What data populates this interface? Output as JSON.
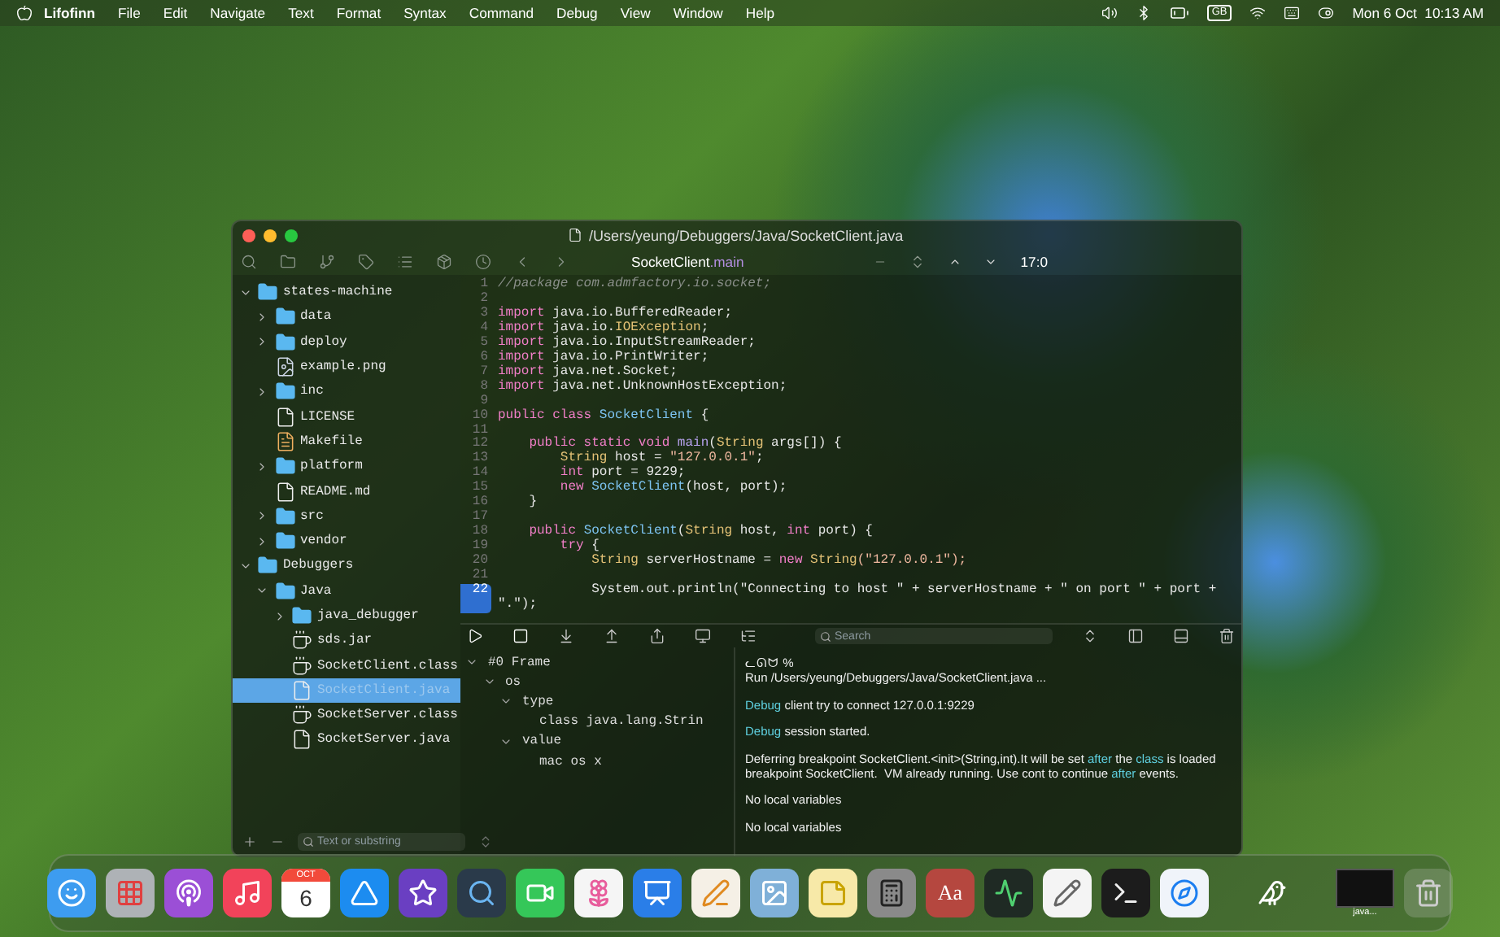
{
  "menu_bar": {
    "app_name": "Lifofinn",
    "menus": [
      "File",
      "Edit",
      "Navigate",
      "Text",
      "Format",
      "Syntax",
      "Command",
      "Debug",
      "View",
      "Window",
      "Help"
    ],
    "input_source": "GB",
    "clock": "Mon 6 Oct  10:13 AM"
  },
  "window": {
    "title": "/Users/yeung/Debuggers/Java/SocketClient.java",
    "breadcrumb": {
      "symbol": "SocketClient",
      "member": ".main"
    },
    "cursor_position": "17:0"
  },
  "sidebar": {
    "tree": [
      {
        "label": "states-machine",
        "kind": "folder",
        "expanded": true,
        "selected": false,
        "children": [
          {
            "label": "data",
            "kind": "folder",
            "expanded": false,
            "selected": false
          },
          {
            "label": "deploy",
            "kind": "folder",
            "expanded": false,
            "selected": false
          },
          {
            "label": "example.png",
            "kind": "image",
            "selected": false
          },
          {
            "label": "inc",
            "kind": "folder",
            "expanded": false,
            "selected": false
          },
          {
            "label": "LICENSE",
            "kind": "document",
            "selected": false
          },
          {
            "label": "Makefile",
            "kind": "makefile",
            "selected": false
          },
          {
            "label": "platform",
            "kind": "folder",
            "expanded": false,
            "selected": false
          },
          {
            "label": "README.md",
            "kind": "document",
            "selected": false
          },
          {
            "label": "src",
            "kind": "folder",
            "expanded": false,
            "selected": false
          },
          {
            "label": "vendor",
            "kind": "folder",
            "expanded": false,
            "selected": false
          }
        ]
      },
      {
        "label": "Debuggers",
        "kind": "folder",
        "expanded": true,
        "selected": false,
        "children": [
          {
            "label": "Java",
            "kind": "folder",
            "expanded": true,
            "selected": false,
            "children": [
              {
                "label": "java_debugger",
                "kind": "folder",
                "expanded": false,
                "selected": false
              },
              {
                "label": "sds.jar",
                "kind": "archive",
                "selected": false
              },
              {
                "label": "SocketClient.class",
                "kind": "archive",
                "selected": false
              },
              {
                "label": "SocketClient.java",
                "kind": "document",
                "selected": true
              },
              {
                "label": "SocketServer.class",
                "kind": "archive",
                "selected": false
              },
              {
                "label": "SocketServer.java",
                "kind": "document",
                "selected": false
              }
            ]
          }
        ]
      }
    ],
    "filter": {
      "placeholder": "Text or substring"
    }
  },
  "editor": {
    "lines": [
      {
        "number": "1",
        "current": false,
        "tokens": [
          {
            "kind": "comment",
            "text": "//package com.admfactory.io.socket;"
          }
        ]
      },
      {
        "number": "2",
        "current": false
      },
      {
        "number": "3",
        "current": false,
        "tokens": [
          {
            "kind": "keyword",
            "text": "import"
          },
          {
            "kind": "plain",
            "text": " java.io.BufferedReader;"
          }
        ]
      },
      {
        "number": "4",
        "current": false,
        "tokens": [
          {
            "kind": "keyword",
            "text": "import"
          },
          {
            "kind": "plain",
            "text": " java.io."
          },
          {
            "kind": "type",
            "text": "IOException"
          },
          {
            "kind": "plain",
            "text": ";"
          }
        ]
      },
      {
        "number": "5",
        "current": false,
        "tokens": [
          {
            "kind": "keyword",
            "text": "import"
          },
          {
            "kind": "plain",
            "text": " java.io.InputStreamReader;"
          }
        ]
      },
      {
        "number": "6",
        "current": false,
        "tokens": [
          {
            "kind": "keyword",
            "text": "import"
          },
          {
            "kind": "plain",
            "text": " java.io.PrintWriter;"
          }
        ]
      },
      {
        "number": "7",
        "current": false,
        "tokens": [
          {
            "kind": "keyword",
            "text": "import"
          },
          {
            "kind": "plain",
            "text": " java.net.Socket;"
          }
        ]
      },
      {
        "number": "8",
        "current": false,
        "tokens": [
          {
            "kind": "keyword",
            "text": "import"
          },
          {
            "kind": "plain",
            "text": " java.net.UnknownHostException;"
          }
        ]
      },
      {
        "number": "9",
        "current": false
      },
      {
        "number": "10",
        "current": false,
        "tokens": [
          {
            "kind": "keyword",
            "text": "public class "
          },
          {
            "kind": "class",
            "text": "SocketClient"
          },
          {
            "kind": "plain",
            "text": " {"
          }
        ]
      },
      {
        "number": "11",
        "current": false
      },
      {
        "number": "12",
        "current": false,
        "tokens": [
          {
            "kind": "keyword",
            "text": "    public static void "
          },
          {
            "kind": "function",
            "text": "main"
          },
          {
            "kind": "plain",
            "text": "("
          },
          {
            "kind": "type",
            "text": "String"
          },
          {
            "kind": "plain",
            "text": " args[]) {"
          }
        ]
      },
      {
        "number": "13",
        "current": false,
        "tokens": [
          {
            "kind": "type",
            "text": "        String"
          },
          {
            "kind": "plain",
            "text": " host = "
          },
          {
            "kind": "string",
            "text": "\"127.0.0.1\""
          },
          {
            "kind": "plain",
            "text": ";"
          }
        ]
      },
      {
        "number": "14",
        "current": false,
        "tokens": [
          {
            "kind": "keyword",
            "text": "        int"
          },
          {
            "kind": "plain",
            "text": " port = 9229;"
          }
        ]
      },
      {
        "number": "15",
        "current": false,
        "tokens": [
          {
            "kind": "keyword",
            "text": "        new "
          },
          {
            "kind": "class",
            "text": "SocketClient"
          },
          {
            "kind": "plain",
            "text": "(host, port);"
          }
        ]
      },
      {
        "number": "16",
        "current": false,
        "tokens": [
          {
            "kind": "plain",
            "text": "    }"
          }
        ]
      },
      {
        "number": "17",
        "current": false
      },
      {
        "number": "18",
        "current": false,
        "tokens": [
          {
            "kind": "keyword",
            "text": "    public "
          },
          {
            "kind": "class",
            "text": "SocketClient"
          },
          {
            "kind": "plain",
            "text": "("
          },
          {
            "kind": "type",
            "text": "String"
          },
          {
            "kind": "plain",
            "text": " host, "
          },
          {
            "kind": "keyword",
            "text": "int"
          },
          {
            "kind": "plain",
            "text": " port) {"
          }
        ]
      },
      {
        "number": "19",
        "current": false,
        "tokens": [
          {
            "kind": "keyword",
            "text": "        try"
          },
          {
            "kind": "plain",
            "text": " {"
          }
        ]
      },
      {
        "number": "20",
        "current": false,
        "tokens": [
          {
            "kind": "type",
            "text": "            String"
          },
          {
            "kind": "plain",
            "text": " serverHostname = "
          },
          {
            "kind": "keyword",
            "text": "new "
          },
          {
            "kind": "type",
            "text": "String"
          },
          {
            "kind": "string",
            "text": "(\"127.0.0.1\");"
          }
        ]
      },
      {
        "number": "21",
        "current": false
      },
      {
        "number": "22",
        "current": true,
        "tokens": [
          {
            "kind": "plain",
            "text": "            System.out.println(\"Connecting to host \" + serverHostname + \" on port \" + port + \".\");"
          }
        ]
      }
    ]
  },
  "debug": {
    "search": {
      "placeholder": "Search"
    },
    "variables": [
      {
        "label": "#0 Frame",
        "expanded": true,
        "children": [
          {
            "label": "os",
            "expanded": true,
            "children": [
              {
                "label": "type",
                "expanded": true,
                "children": [
                  {
                    "label": "class java.lang.Strin"
                  }
                ]
              },
              {
                "label": "value",
                "expanded": true,
                "children": [
                  {
                    "label": "mac os x"
                  }
                ]
              }
            ]
          }
        ]
      }
    ],
    "console": [
      [
        [
          {
            "kind": "prompt",
            "text": "ᓚᘏᗢ %"
          }
        ],
        [
          {
            "kind": "plain",
            "text": "Run /Users/yeung/Debuggers/Java/SocketClient.java ..."
          }
        ]
      ],
      [
        [
          {
            "kind": "keyword",
            "text": "Debug"
          },
          {
            "kind": "plain",
            "text": " client try to connect 127.0.0.1:9229"
          }
        ]
      ],
      [
        [
          {
            "kind": "keyword",
            "text": "Debug"
          },
          {
            "kind": "plain",
            "text": " session started."
          }
        ]
      ],
      [
        [
          {
            "kind": "plain",
            "text": "Deferring breakpoint SocketClient.<init>(String,int).It will be set "
          },
          {
            "kind": "keyword",
            "text": "after"
          },
          {
            "kind": "plain",
            "text": " the "
          },
          {
            "kind": "keyword",
            "text": "class"
          },
          {
            "kind": "plain",
            "text": " is loaded"
          }
        ],
        [
          {
            "kind": "plain",
            "text": "breakpoint SocketClient.  VM already running. Use cont to continue "
          },
          {
            "kind": "keyword",
            "text": "after"
          },
          {
            "kind": "plain",
            "text": " events."
          }
        ]
      ],
      [
        [
          {
            "kind": "plain",
            "text": "No local variables"
          }
        ]
      ],
      [
        [
          {
            "kind": "plain",
            "text": "No local variables"
          }
        ]
      ]
    ]
  },
  "dock": {
    "sections": [
      {
        "items": [
          {
            "kind": "finder"
          },
          {
            "kind": "launchpad"
          },
          {
            "kind": "podcasts"
          },
          {
            "kind": "music"
          },
          {
            "kind": "calendar",
            "month": "OCT",
            "day": "6"
          },
          {
            "kind": "appstore"
          },
          {
            "kind": "imovie"
          },
          {
            "kind": "quicktime"
          },
          {
            "kind": "facetime"
          },
          {
            "kind": "photos"
          },
          {
            "kind": "keynote"
          },
          {
            "kind": "pages"
          },
          {
            "kind": "preview"
          },
          {
            "kind": "notes"
          },
          {
            "kind": "calculator"
          },
          {
            "kind": "dictionary",
            "label": "Aa"
          },
          {
            "kind": "activity"
          },
          {
            "kind": "textedit"
          },
          {
            "kind": "terminal"
          },
          {
            "kind": "safari"
          }
        ]
      },
      {
        "items": [
          {
            "kind": "bird"
          }
        ]
      },
      {
        "items": [
          {
            "kind": "thumbnail",
            "label": "java..."
          },
          {
            "kind": "trash"
          }
        ]
      }
    ]
  }
}
